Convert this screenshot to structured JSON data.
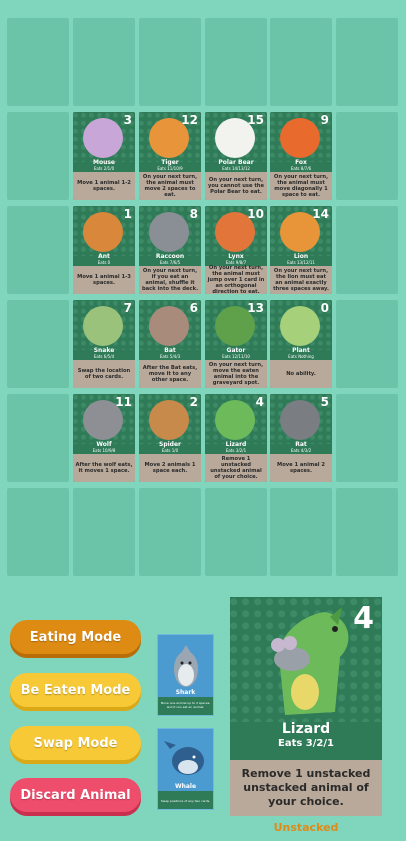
{
  "colors": {
    "background": "#7fd6bc",
    "board_cell": "#6cc4a8",
    "card_bg": "#2f7a57",
    "ability_bg": "#b9a99a",
    "status_text": "#e08a17"
  },
  "board": {
    "cards": [
      {
        "name": "Mouse",
        "number": "3",
        "eats": "Eats 2/1/0",
        "ability": "Move 1 animal 1-2 spaces.",
        "color": "#c9a6d8",
        "icon": "mouse-icon"
      },
      {
        "name": "Tiger",
        "number": "12",
        "eats": "Eats 11/10/9",
        "ability": "On your next turn, the animal must move 2 spaces to eat.",
        "color": "#e8943a",
        "icon": "tiger-icon"
      },
      {
        "name": "Polar Bear",
        "number": "15",
        "eats": "Eats 14/13/12",
        "ability": "On your next turn, you cannot use the Polar Bear to eat.",
        "color": "#f2f2ef",
        "icon": "polar-bear-icon"
      },
      {
        "name": "Fox",
        "number": "9",
        "eats": "Eats 8/7/6",
        "ability": "On your next turn, the animal must move diagonally 1 space to eat.",
        "color": "#e86a2c",
        "icon": "fox-icon"
      },
      {
        "name": "Ant",
        "number": "1",
        "eats": "Eats 0",
        "ability": "Move 1 animal 1-3 spaces.",
        "color": "#d9873a",
        "icon": "ant-icon"
      },
      {
        "name": "Raccoon",
        "number": "8",
        "eats": "Eats 7/6/5",
        "ability": "On your next turn, if you eat an animal, shuffle it back into the deck.",
        "color": "#8a8f96",
        "icon": "raccoon-icon"
      },
      {
        "name": "Lynx",
        "number": "10",
        "eats": "Eats 9/8/7",
        "ability": "On your next turn, the animal must jump over 1 card in an orthogonal direction to eat.",
        "color": "#e2763a",
        "icon": "lynx-icon"
      },
      {
        "name": "Lion",
        "number": "14",
        "eats": "Eats 13/12/11",
        "ability": "On your next turn, the lion must eat an animal exactly three spaces away.",
        "color": "#e8953a",
        "icon": "lion-icon"
      },
      {
        "name": "Snake",
        "number": "7",
        "eats": "Eats 6/5/4",
        "ability": "Swap the location of two cards.",
        "color": "#9bc27a",
        "icon": "snake-icon"
      },
      {
        "name": "Bat",
        "number": "6",
        "eats": "Eats 5/4/3",
        "ability": "After the Bat eats, move it to any other space.",
        "color": "#a88b7a",
        "icon": "bat-icon"
      },
      {
        "name": "Gator",
        "number": "13",
        "eats": "Eats 12/11/10",
        "ability": "On your next turn, move the eaten animal into the graveyard spot.",
        "color": "#5fa04a",
        "icon": "gator-icon"
      },
      {
        "name": "Plant",
        "number": "0",
        "eats": "Eats Nothing",
        "ability": "No ability.",
        "color": "#a6d07a",
        "icon": "plant-icon"
      },
      {
        "name": "Wolf",
        "number": "11",
        "eats": "Eats 10/9/8",
        "ability": "After the wolf eats, it moves 1 space.",
        "color": "#8d8f95",
        "icon": "wolf-icon"
      },
      {
        "name": "Spider",
        "number": "2",
        "eats": "Eats 1/0",
        "ability": "Move 2 animals 1 space each.",
        "color": "#c88a4a",
        "icon": "spider-icon"
      },
      {
        "name": "Lizard",
        "number": "4",
        "eats": "Eats 3/2/1",
        "ability": "Remove 1 unstacked unstacked animal of your choice.",
        "color": "#6cba5a",
        "icon": "lizard-icon"
      },
      {
        "name": "Rat",
        "number": "5",
        "eats": "Eats 4/3/2",
        "ability": "Move 1 animal 2 spaces.",
        "color": "#7a7d82",
        "icon": "rat-icon"
      }
    ]
  },
  "buttons": {
    "eating_mode": "Eating Mode",
    "be_eaten_mode": "Be Eaten Mode",
    "swap_mode": "Swap Mode",
    "discard_animal": "Discard Animal"
  },
  "hand": [
    {
      "name": "Shark",
      "ability": "Move one animal up to 2 spaces, and it can eat an animal.",
      "icon": "shark-icon"
    },
    {
      "name": "Whale",
      "ability": "Swap positions of any two cards.",
      "icon": "whale-icon"
    }
  ],
  "selected": {
    "name": "Lizard",
    "number": "4",
    "eats": "Eats 3/2/1",
    "ability": "Remove 1 unstacked unstacked animal of your choice.",
    "status": "Unstacked",
    "icon": "lizard-icon"
  }
}
